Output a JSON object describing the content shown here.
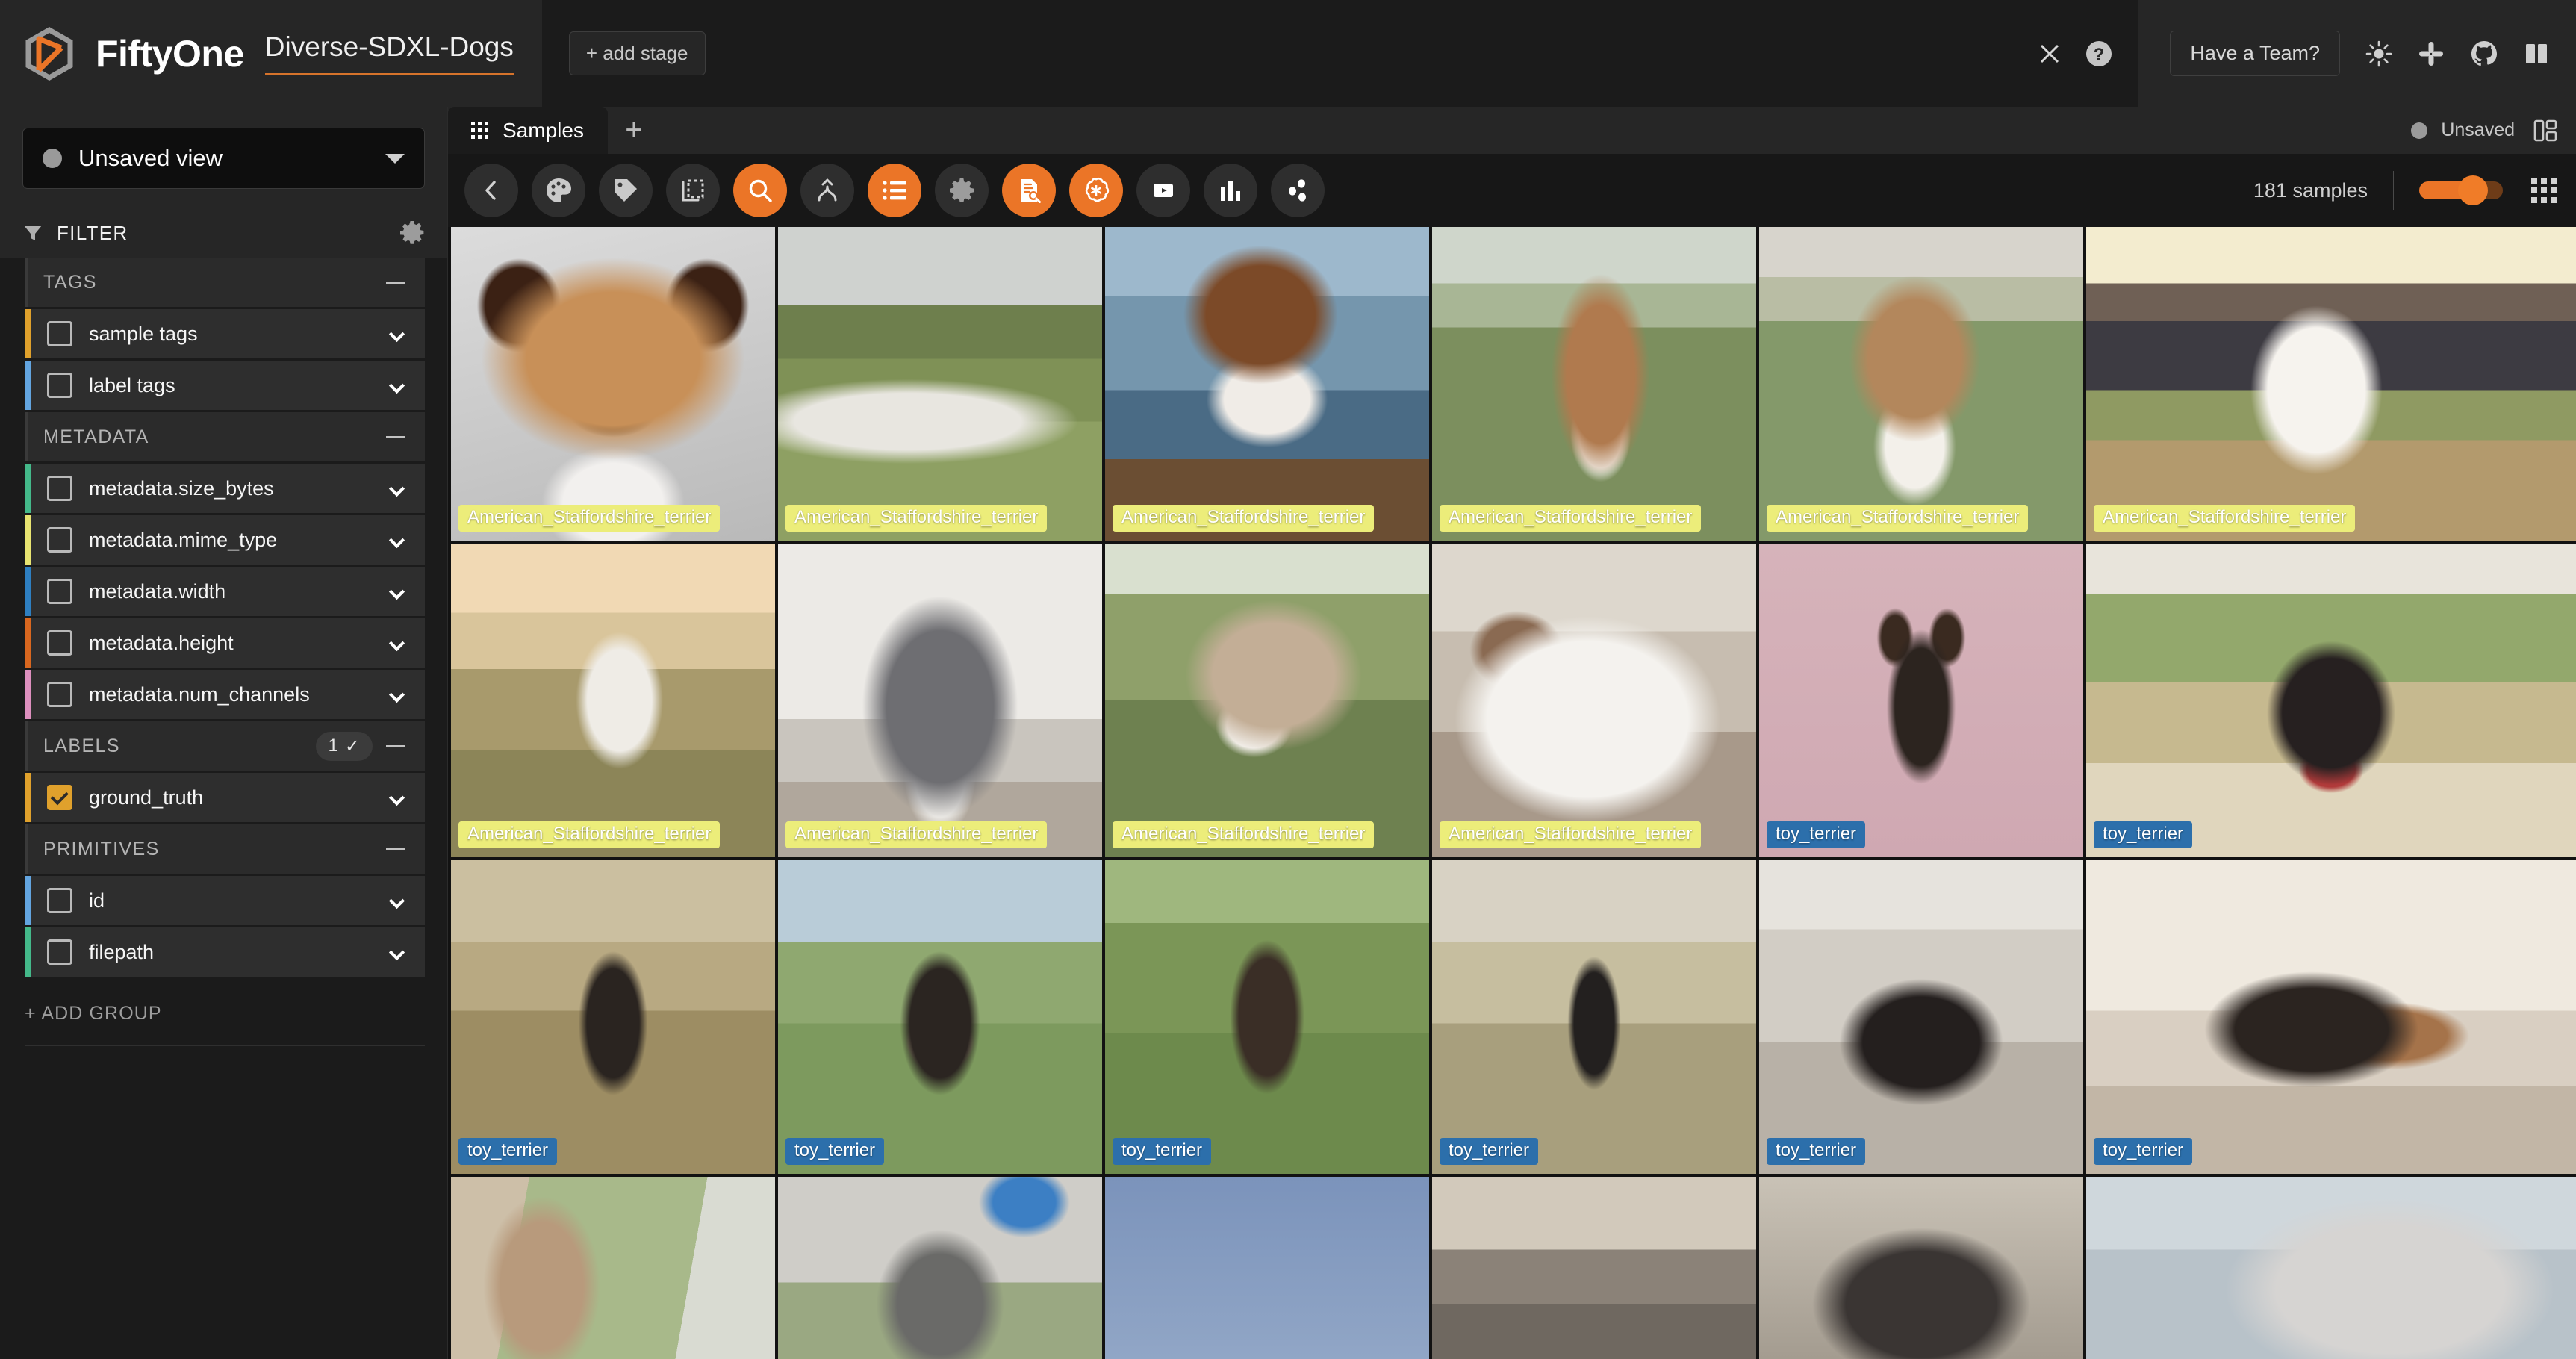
{
  "header": {
    "brand": "FiftyOne",
    "dataset_name": "Diverse-SDXL-Dogs",
    "add_stage_label": "+ add stage",
    "close_icon": "close-icon",
    "help_icon": "help-circle-icon",
    "have_a_team_label": "Have a Team?",
    "icons": [
      "sun-icon",
      "slack-icon",
      "github-icon",
      "docs-book-icon"
    ],
    "accent_color": "#eb7527",
    "logo_color": "#eb7527"
  },
  "sidebar": {
    "view_selector": {
      "label": "Unsaved view",
      "status_dot_color": "#9a9a9a"
    },
    "filter_header": {
      "label": "FILTER",
      "filter_icon": "funnel-icon",
      "settings_icon": "gear-icon"
    },
    "groups": [
      {
        "title": "TAGS",
        "collapse_glyph": "minus",
        "count": null,
        "fields": [
          {
            "label": "sample tags",
            "checked": false,
            "color": "#e0a12c"
          },
          {
            "label": "label tags",
            "checked": false,
            "color": "#63a5e0"
          }
        ]
      },
      {
        "title": "METADATA",
        "collapse_glyph": "minus",
        "count": null,
        "fields": [
          {
            "label": "metadata.size_bytes",
            "checked": false,
            "color": "#44b98a"
          },
          {
            "label": "metadata.mime_type",
            "checked": false,
            "color": "#e8e471"
          },
          {
            "label": "metadata.width",
            "checked": false,
            "color": "#2e7fc1"
          },
          {
            "label": "metadata.height",
            "checked": false,
            "color": "#d9671f"
          },
          {
            "label": "metadata.num_channels",
            "checked": false,
            "color": "#dd8fbe"
          }
        ]
      },
      {
        "title": "LABELS",
        "collapse_glyph": "minus",
        "count": "1",
        "count_check": "✓",
        "fields": [
          {
            "label": "ground_truth",
            "checked": true,
            "color": "#e0a12c"
          }
        ]
      },
      {
        "title": "PRIMITIVES",
        "collapse_glyph": "minus",
        "count": null,
        "fields": [
          {
            "label": "id",
            "checked": false,
            "color": "#63a5e0"
          },
          {
            "label": "filepath",
            "checked": false,
            "color": "#44b98a"
          }
        ]
      }
    ],
    "add_group_label": "+ ADD GROUP"
  },
  "main": {
    "tabs": [
      {
        "label": "Samples",
        "icon": "grid-dots-icon",
        "active": true
      }
    ],
    "new_tab_label": "+",
    "unsaved_status": {
      "label": "Unsaved",
      "dot_color": "#9a9a9a",
      "layout_icon": "panel-layout-icon"
    },
    "toolbar_buttons": [
      {
        "name": "back-chevron-icon",
        "active": false
      },
      {
        "name": "color-palette-icon",
        "active": false
      },
      {
        "name": "tag-icon",
        "active": false
      },
      {
        "name": "patches-selection-icon",
        "active": false
      },
      {
        "name": "search-magnifier-icon",
        "active": true
      },
      {
        "name": "similarity-sort-icon",
        "active": false
      },
      {
        "name": "list-view-icon",
        "active": true
      },
      {
        "name": "settings-gear-icon",
        "active": false
      },
      {
        "name": "document-search-icon",
        "active": true
      },
      {
        "name": "openai-logo-icon",
        "active": true
      },
      {
        "name": "video-play-icon",
        "active": false
      },
      {
        "name": "bar-chart-icon",
        "active": false
      },
      {
        "name": "scatter-points-icon",
        "active": false
      }
    ],
    "samples_count_label": "181 samples",
    "zoom_slider_value": 62,
    "grid_toggle_icon": "grid-9-dots-icon"
  },
  "grid": {
    "columns": 6,
    "label_colors": {
      "American_Staffordshire_terrier": "#eced7a",
      "toy_terrier": "#2c6fab"
    },
    "rows": [
      {
        "cells": [
          {
            "label": "American_Staffordshire_terrier",
            "cls": "ast"
          },
          {
            "label": "American_Staffordshire_terrier",
            "cls": "ast"
          },
          {
            "label": "American_Staffordshire_terrier",
            "cls": "ast"
          },
          {
            "label": "American_Staffordshire_terrier",
            "cls": "ast"
          },
          {
            "label": "American_Staffordshire_terrier",
            "cls": "ast"
          },
          {
            "label": "American_Staffordshire_terrier",
            "cls": "ast"
          }
        ]
      },
      {
        "cells": [
          {
            "label": "American_Staffordshire_terrier",
            "cls": "ast"
          },
          {
            "label": "American_Staffordshire_terrier",
            "cls": "ast"
          },
          {
            "label": "American_Staffordshire_terrier",
            "cls": "ast"
          },
          {
            "label": "American_Staffordshire_terrier",
            "cls": "ast"
          },
          {
            "label": "toy_terrier",
            "cls": "toy"
          },
          {
            "label": "toy_terrier",
            "cls": "toy"
          }
        ]
      },
      {
        "cells": [
          {
            "label": "toy_terrier",
            "cls": "toy"
          },
          {
            "label": "toy_terrier",
            "cls": "toy"
          },
          {
            "label": "toy_terrier",
            "cls": "toy"
          },
          {
            "label": "toy_terrier",
            "cls": "toy"
          },
          {
            "label": "toy_terrier",
            "cls": "toy"
          },
          {
            "label": "toy_terrier",
            "cls": "toy"
          }
        ]
      },
      {
        "cells": [
          {
            "label": "",
            "cls": ""
          },
          {
            "label": "",
            "cls": ""
          },
          {
            "label": "",
            "cls": ""
          },
          {
            "label": "",
            "cls": ""
          },
          {
            "label": "",
            "cls": ""
          },
          {
            "label": "",
            "cls": ""
          }
        ]
      }
    ]
  }
}
